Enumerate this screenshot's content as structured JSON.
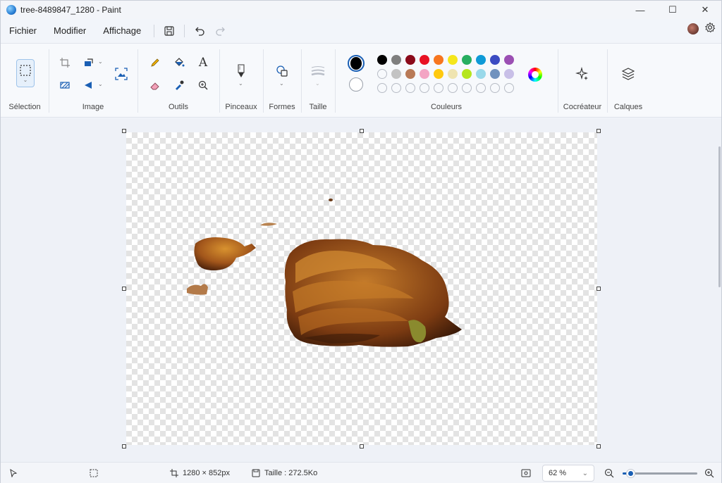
{
  "window": {
    "title": "tree-8489847_1280 - Paint",
    "controls": {
      "minimize": "—",
      "maximize": "☐",
      "close": "✕"
    }
  },
  "menu": {
    "items": [
      "Fichier",
      "Modifier",
      "Affichage"
    ]
  },
  "ribbon": {
    "groups": {
      "selection": "Sélection",
      "image": "Image",
      "outils": "Outils",
      "pinceaux": "Pinceaux",
      "formes": "Formes",
      "taille": "Taille",
      "couleurs": "Couleurs",
      "cocreateur": "Cocréateur",
      "calques": "Calques"
    },
    "primary_color": "#000000",
    "secondary_color": "#ffffff",
    "palette_row1": [
      "#000000",
      "#7f7f7f",
      "#8b0a1a",
      "#e81123",
      "#f7761f",
      "#f5e61b",
      "#27ae60",
      "#0e9ad7",
      "#3b4bc2",
      "#9b4fb3"
    ],
    "palette_row2": [
      "#ffffff",
      "#c3c3c3",
      "#b97a57",
      "#f3a5c4",
      "#ffc90e",
      "#efe4b0",
      "#b5e61d",
      "#99d9ea",
      "#7092be",
      "#c8bfe7"
    ],
    "palette_row3_count": 10
  },
  "status": {
    "dimensions": "1280 × 852px",
    "size": "Taille : 272.5Ko",
    "zoom": "62 %",
    "zoom_fraction": 0.1
  }
}
